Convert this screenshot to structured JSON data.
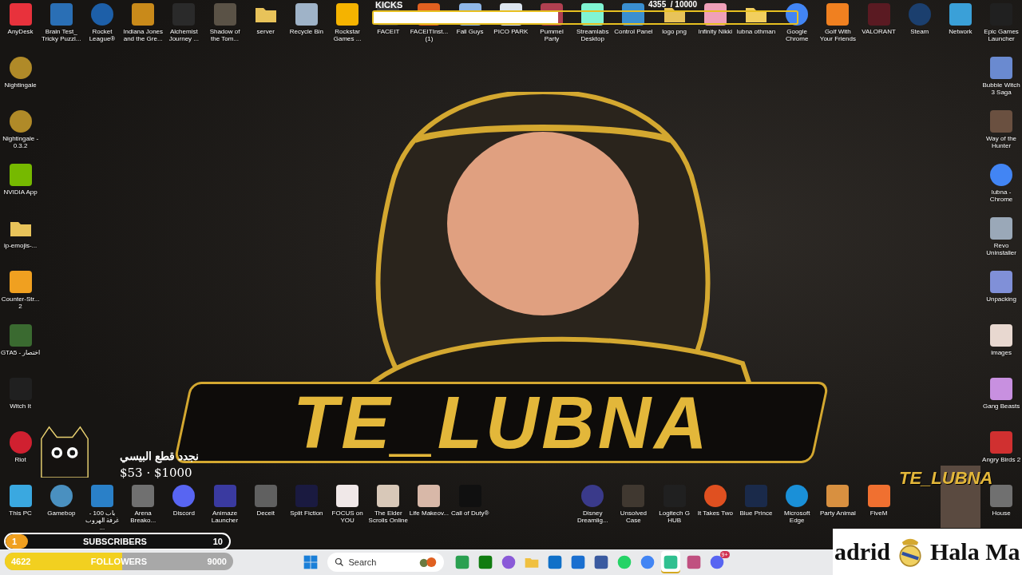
{
  "desktop": {
    "top_row": [
      {
        "label": "AnyDesk",
        "kind": "tile",
        "color": "#e8323c"
      },
      {
        "label": "Brain Test_ Tricky Puzzl...",
        "kind": "tile",
        "color": "#2a6fb5"
      },
      {
        "label": "Rocket League®",
        "kind": "round",
        "color": "#1d5fa8"
      },
      {
        "label": "Indiana Jones and the Gre...",
        "kind": "tile",
        "color": "#c98a1a"
      },
      {
        "label": "Alchemist Journey ...",
        "kind": "tile",
        "color": "#2a2a2a"
      },
      {
        "label": "Shadow of the Tom...",
        "kind": "tile",
        "color": "#5a5246"
      },
      {
        "label": "server",
        "kind": "folder",
        "color": "#e8c35a"
      },
      {
        "label": "Recycle Bin",
        "kind": "tile",
        "color": "#9fb3c8"
      },
      {
        "label": "Rockstar Games ...",
        "kind": "tile",
        "color": "#f5b300"
      },
      {
        "label": "FACEIT",
        "kind": "tile",
        "color": "#3a3a3a"
      },
      {
        "label": "FACEITInst... (1)",
        "kind": "tile",
        "color": "#e06020"
      },
      {
        "label": "Fall Guys",
        "kind": "tile",
        "color": "#8fb7e8"
      },
      {
        "label": "PICO PARK",
        "kind": "tile",
        "color": "#dde6f0"
      },
      {
        "label": "Pummel Party",
        "kind": "tile",
        "color": "#b04050"
      },
      {
        "label": "Streamlabs Desktop",
        "kind": "tile",
        "color": "#80f5d2"
      },
      {
        "label": "Control Panel",
        "kind": "tile",
        "color": "#3a8fd0"
      },
      {
        "label": "logo png",
        "kind": "folder",
        "color": "#e8c35a"
      },
      {
        "label": "Infinity Nikki",
        "kind": "tile",
        "color": "#f0a0b8"
      },
      {
        "label": "lubna othman",
        "kind": "folder",
        "color": "#f2cf5e"
      },
      {
        "label": "Google Chrome",
        "kind": "round",
        "color": "#4285f4"
      },
      {
        "label": "Golf With Your Friends",
        "kind": "tile",
        "color": "#f08020"
      },
      {
        "label": "VALORANT",
        "kind": "tile",
        "color": "#5a1a22"
      },
      {
        "label": "Steam",
        "kind": "round",
        "color": "#1b3f6e"
      },
      {
        "label": "Network",
        "kind": "tile",
        "color": "#3aa0d8"
      },
      {
        "label": "Epic Games Launcher",
        "kind": "tile",
        "color": "#202020"
      }
    ],
    "left_column": [
      {
        "label": "Nightingale",
        "kind": "round",
        "color": "#b08a28"
      },
      {
        "label": "Nightingale - 0.3.2",
        "kind": "round",
        "color": "#b08a28"
      },
      {
        "label": "NVIDIA App",
        "kind": "tile",
        "color": "#76b900"
      },
      {
        "label": "ip-emojis-...",
        "kind": "folder",
        "color": "#e8c35a"
      },
      {
        "label": "Counter-Str... 2",
        "kind": "tile",
        "color": "#f0a020"
      },
      {
        "label": "GTA5 - اختصار",
        "kind": "tile",
        "color": "#3a6a30"
      },
      {
        "label": "Witch It",
        "kind": "tile",
        "color": "#202020"
      },
      {
        "label": "Riot",
        "kind": "round",
        "color": "#d02030"
      }
    ],
    "right_column": [
      {
        "label": "Bubble Witch 3 Saga",
        "kind": "tile",
        "color": "#6a8ad0"
      },
      {
        "label": "Way of the Hunter",
        "kind": "tile",
        "color": "#6a5040"
      },
      {
        "label": "lubna - Chrome",
        "kind": "round",
        "color": "#4285f4"
      },
      {
        "label": "Revo Uninstaller",
        "kind": "tile",
        "color": "#9aa8b8"
      },
      {
        "label": "Unpacking",
        "kind": "tile",
        "color": "#8090d8"
      },
      {
        "label": "images",
        "kind": "tile",
        "color": "#e8d8d0"
      },
      {
        "label": "Gang Beasts",
        "kind": "tile",
        "color": "#c890e0"
      },
      {
        "label": "Angry Birds 2",
        "kind": "tile",
        "color": "#d03030"
      }
    ],
    "bottom_row_left": [
      {
        "label": "This PC",
        "kind": "tile",
        "color": "#3aa8e0"
      },
      {
        "label": "Gamebop",
        "kind": "round",
        "color": "#4a90c0"
      },
      {
        "label": "باب 100 - غرفة الهروب ...",
        "kind": "tile",
        "color": "#2a80c8"
      },
      {
        "label": "Arena Breako...",
        "kind": "tile",
        "color": "#707070"
      },
      {
        "label": "Discord",
        "kind": "round",
        "color": "#5865f2"
      },
      {
        "label": "Animaze Launcher",
        "kind": "tile",
        "color": "#3a3aa0"
      },
      {
        "label": "Deceit",
        "kind": "tile",
        "color": "#606060"
      },
      {
        "label": "Split Fiction",
        "kind": "tile",
        "color": "#1a1a40"
      },
      {
        "label": "FOCUS on YOU",
        "kind": "tile",
        "color": "#f0e8e8"
      },
      {
        "label": "The Elder Scrolls Online",
        "kind": "tile",
        "color": "#d8c8b8"
      },
      {
        "label": "Life Makeov...",
        "kind": "tile",
        "color": "#d8b8a8"
      },
      {
        "label": "Call of Duty®",
        "kind": "tile",
        "color": "#101010"
      }
    ],
    "bottom_row_right": [
      {
        "label": "Disney Dreamlig...",
        "kind": "round",
        "color": "#3a3a8a"
      },
      {
        "label": "Unsolved Case",
        "kind": "tile",
        "color": "#403830"
      },
      {
        "label": "Logitech G HUB",
        "kind": "tile",
        "color": "#202020"
      },
      {
        "label": "It Takes Two",
        "kind": "round",
        "color": "#e05020"
      },
      {
        "label": "Blue Prince",
        "kind": "tile",
        "color": "#1a2a4a"
      },
      {
        "label": "Microsoft Edge",
        "kind": "round",
        "color": "#1a90d8"
      },
      {
        "label": "Party Animal",
        "kind": "tile",
        "color": "#d89040"
      },
      {
        "label": "FiveM",
        "kind": "tile",
        "color": "#f07030"
      }
    ],
    "bottom_corner": [
      {
        "label": "House",
        "kind": "tile",
        "color": "#707070"
      }
    ]
  },
  "kicks_goal": {
    "title": "KICKS",
    "count": "4355  / 10000",
    "level": 0.4355
  },
  "logo": {
    "text": "TE_LUBNA"
  },
  "donation_goal": {
    "title": "نجدد قطع البيسي",
    "amount": "$53 · $1000"
  },
  "subscribers_goal": {
    "current": "1",
    "title": "SUBSCRIBERS",
    "target": "10",
    "level": 0.1
  },
  "followers_goal": {
    "current": "4622",
    "title": "FOLLOWERS",
    "target": "9000",
    "level": 0.5136
  },
  "webcam": {
    "logo": "TE_LUBNA"
  },
  "banner": {
    "left_text": "adrid",
    "right_text": "Hala Ma"
  },
  "taskbar": {
    "search": {
      "placeholder": "Search"
    },
    "apps": [
      {
        "kind": "tile",
        "color": "#2aa050",
        "selected": false
      },
      {
        "kind": "tile",
        "color": "#107c10",
        "selected": false
      },
      {
        "kind": "round",
        "color": "#8a5ad8",
        "selected": false
      },
      {
        "kind": "folder",
        "color": "#f0c040",
        "selected": false
      },
      {
        "kind": "tile",
        "color": "#1070c8",
        "selected": false
      },
      {
        "kind": "tile",
        "color": "#1a6fd0",
        "selected": false
      },
      {
        "kind": "tile",
        "color": "#3a5aa0",
        "selected": false
      },
      {
        "kind": "round",
        "color": "#25d366",
        "selected": false
      },
      {
        "kind": "round",
        "color": "#4285f4",
        "selected": false
      },
      {
        "kind": "tile",
        "color": "#30c090",
        "selected": true
      },
      {
        "kind": "tile",
        "color": "#c05080",
        "selected": false
      },
      {
        "kind": "round",
        "color": "#5865f2",
        "selected": false,
        "badge": "9+"
      }
    ]
  }
}
